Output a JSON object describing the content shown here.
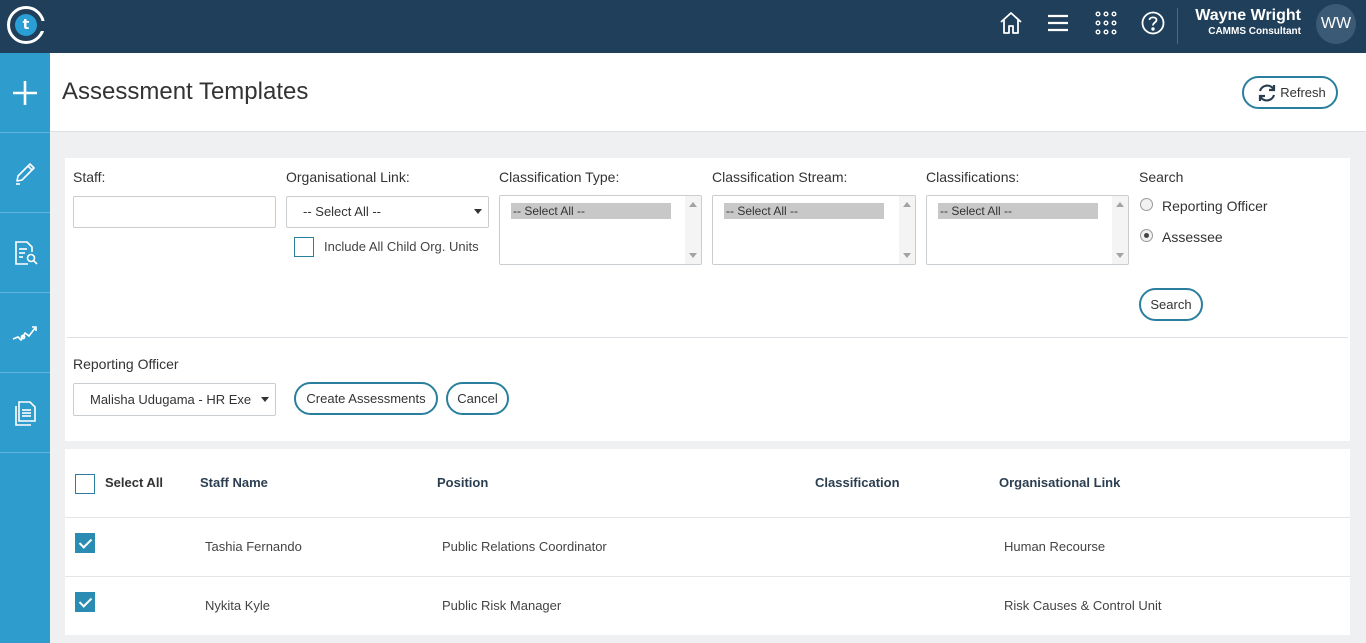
{
  "topbar": {
    "logo_letter": "t",
    "icons": [
      "home-icon",
      "menu-icon",
      "apps-grid-icon",
      "help-icon"
    ],
    "user_name": "Wayne Wright",
    "user_role": "CAMMS Consultant",
    "avatar_initials": "WW"
  },
  "sidebar": {
    "items": [
      "add-icon",
      "edit-icon",
      "document-search-icon",
      "analytics-icon",
      "documents-icon"
    ]
  },
  "header": {
    "title": "Assessment Templates",
    "refresh_label": "Refresh"
  },
  "filters": {
    "staff_label": "Staff:",
    "staff_value": "",
    "org_link_label": "Organisational Link:",
    "org_link_value": "-- Select All --",
    "include_child_label": "Include All Child Org. Units",
    "include_child_checked": false,
    "class_type_label": "Classification Type:",
    "class_type_option": "-- Select All --",
    "class_stream_label": "Classification Stream:",
    "class_stream_option": "-- Select All --",
    "classifications_label": "Classifications:",
    "classifications_option": "-- Select All --",
    "search_label": "Search",
    "search_options": [
      "Reporting Officer",
      "Assessee"
    ],
    "search_selected": "Assessee",
    "search_button": "Search"
  },
  "assessment": {
    "reporting_officer_label": "Reporting Officer",
    "reporting_officer_value": "Malisha Udugama - HR Exe",
    "create_button": "Create Assessments",
    "cancel_button": "Cancel"
  },
  "table": {
    "select_all_label": "Select All",
    "columns": [
      "Staff Name",
      "Position",
      "Classification",
      "Organisational Link"
    ],
    "rows": [
      {
        "checked": true,
        "staff_name": "Tashia Fernando",
        "position": "Public Relations Coordinator",
        "classification": "",
        "org_link": "Human Recourse"
      },
      {
        "checked": true,
        "staff_name": "Nykita Kyle",
        "position": "Public Risk Manager",
        "classification": "",
        "org_link": "Risk Causes & Control Unit"
      }
    ]
  },
  "colors": {
    "topbar": "#1f3f5b",
    "sidebar": "#2e9ccd",
    "accent": "#2a7f9e"
  }
}
